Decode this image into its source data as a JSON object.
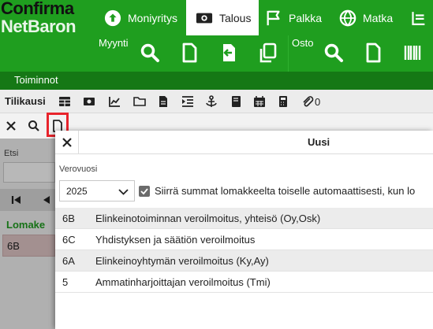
{
  "logo": {
    "line1": "Confirma",
    "line2": "NetBaron"
  },
  "tabs": [
    {
      "label": "Moniyritys",
      "icon": "cloud-upload-icon"
    },
    {
      "label": "Talous",
      "icon": "money-icon",
      "active": true
    },
    {
      "label": "Palkka",
      "icon": "flag-icon"
    },
    {
      "label": "Matka",
      "icon": "globe-icon"
    }
  ],
  "sections": {
    "sales_label": "Myynti",
    "sales_icons": [
      "search-icon",
      "document-icon",
      "file-import-icon",
      "copy-icon"
    ],
    "purchase_label": "Osto",
    "purchase_icons": [
      "search-icon",
      "document-icon",
      "barcode-icon"
    ]
  },
  "toolbar": {
    "label": "Toiminnot"
  },
  "tilikausi": {
    "label": "Tilikausi",
    "attachment_count": "0"
  },
  "left_panel": {
    "search_label": "Etsi",
    "list_header": "Lomake",
    "selected_item": "6B"
  },
  "dialog": {
    "title": "Uusi",
    "year_label": "Verovuosi",
    "year_value": "2025",
    "checkbox_label": "Siirrä summat lomakkeelta toiselle automaattisesti, kun lo",
    "checkbox_checked": true,
    "forms": [
      {
        "code": "6B",
        "name": "Elinkeinotoiminnan veroilmoitus, yhteisö (Oy,Osk)"
      },
      {
        "code": "6C",
        "name": "Yhdistyksen ja säätiön veroilmoitus"
      },
      {
        "code": "6A",
        "name": "Elinkeinoyhtymän veroilmoitus (Ky,Ay)"
      },
      {
        "code": "5",
        "name": "Ammatinharjoittajan veroilmoitus (Tmi)"
      }
    ]
  },
  "colors": {
    "brand_green": "#1f9e1f",
    "dark_green": "#157815",
    "highlight_red": "#e8242c"
  }
}
